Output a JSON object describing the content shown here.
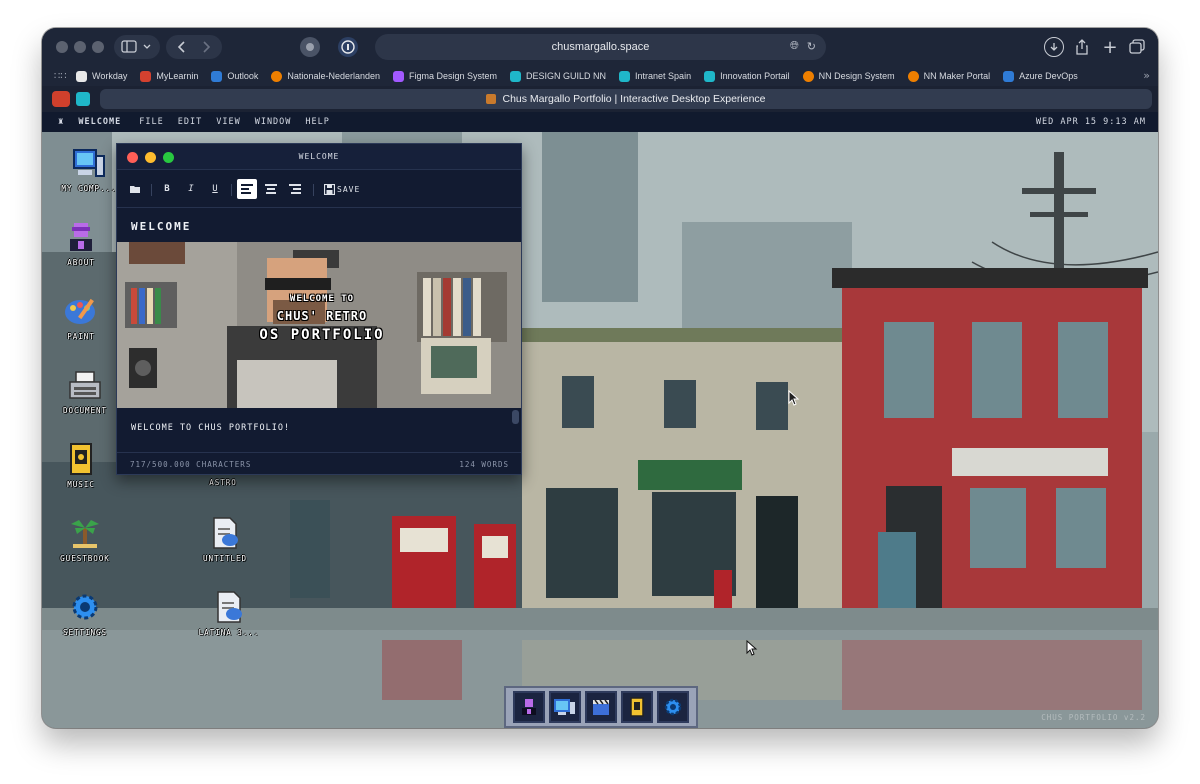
{
  "browser": {
    "url": "chusmargallo.space",
    "tab_title": "Chus Margallo Portfolio | Interactive Desktop Experience",
    "bookmarks": [
      {
        "label": "Workday",
        "color": "#e8e8e8"
      },
      {
        "label": "MyLearnin",
        "color": "#d4412f"
      },
      {
        "label": "Outlook",
        "color": "#2f7bd6"
      },
      {
        "label": "Nationale-Nederlanden",
        "color": "#ee7f00"
      },
      {
        "label": "Figma Design System",
        "color": "#a259ff"
      },
      {
        "label": "DESIGN GUILD NN",
        "color": "#1fb7c9"
      },
      {
        "label": "Intranet Spain",
        "color": "#1fb7c9"
      },
      {
        "label": "Innovation Portail",
        "color": "#1fb7c9"
      },
      {
        "label": "NN Design System",
        "color": "#ee7f00"
      },
      {
        "label": "NN Maker Portal",
        "color": "#ee7f00"
      },
      {
        "label": "Azure DevOps",
        "color": "#2f7bd6"
      }
    ]
  },
  "os": {
    "logo": "♜",
    "app_name": "WELCOME",
    "menus": [
      "FILE",
      "EDIT",
      "VIEW",
      "WINDOW",
      "HELP"
    ],
    "clock": "WED APR 15  9:13 AM",
    "watermark": "CHUS PORTFOLIO v2.2"
  },
  "desktop_icons": {
    "my_computer": "MY COMP...",
    "about": "ABOUT",
    "paint": "PAINT",
    "document": "DOCUMENT",
    "music": "MUSIC",
    "astro": "ASTRO",
    "guestbook": "GUESTBOOK",
    "untitled": "UNTITLED",
    "settings": "SETTINGS",
    "latina": "LATINA 3..."
  },
  "welcome_window": {
    "title": "WELCOME",
    "toolbar": {
      "bold": "B",
      "italic": "I",
      "underline": "U",
      "save": "SAVE"
    },
    "doc_heading": "WELCOME",
    "hero": {
      "line1": "WELCOME TO",
      "line2": "CHUS' RETRO",
      "line3": "OS PORTFOLIO"
    },
    "body": "WELCOME TO CHUS PORTFOLIO!",
    "char_count": "717/500.000 CHARACTERS",
    "word_count": "124 WORDS"
  },
  "colors": {
    "close": "#ff5f57",
    "minimize": "#febc2e",
    "maximize": "#28c840",
    "accent": "#1fb7c9"
  }
}
